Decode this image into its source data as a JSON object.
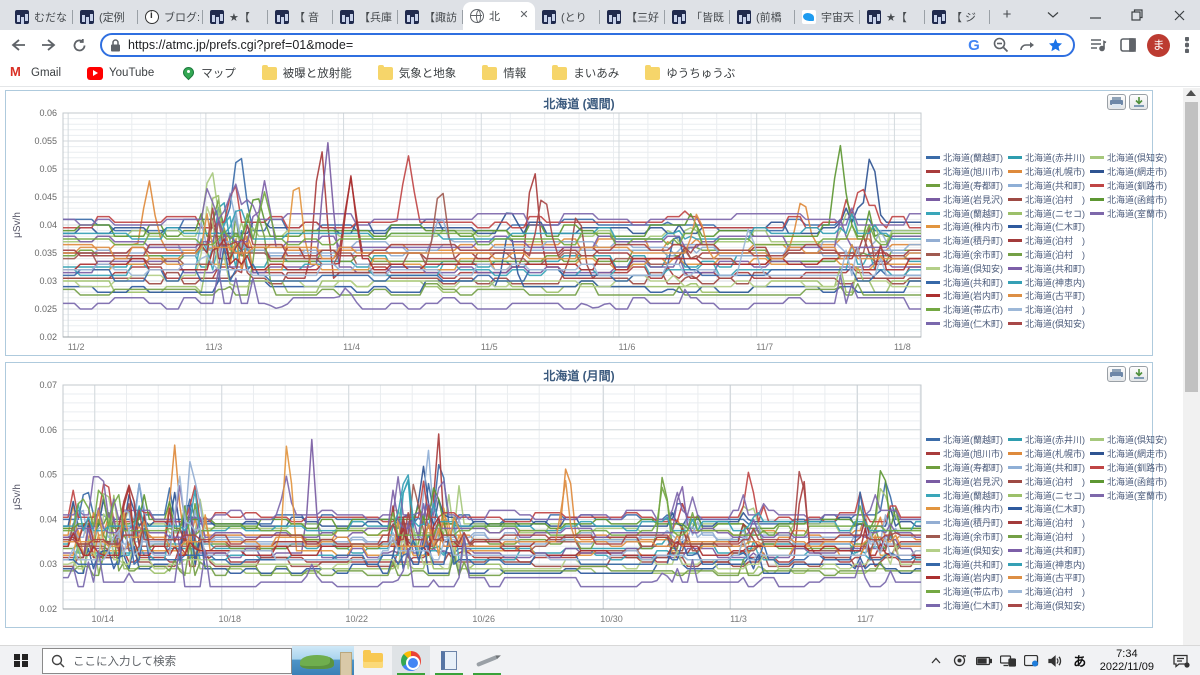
{
  "browser": {
    "tabs": [
      {
        "label": "むだな",
        "icon": "site"
      },
      {
        "label": "(定例",
        "icon": "site"
      },
      {
        "label": "ブログ:",
        "icon": "info"
      },
      {
        "label": "★【",
        "icon": "site"
      },
      {
        "label": "【 音",
        "icon": "site"
      },
      {
        "label": "【兵庫",
        "icon": "site"
      },
      {
        "label": "【諏訪",
        "icon": "site"
      },
      {
        "label": "北",
        "icon": "globe",
        "active": true
      },
      {
        "label": "(とり",
        "icon": "site"
      },
      {
        "label": "【三好",
        "icon": "site"
      },
      {
        "label": "「皆既",
        "icon": "site"
      },
      {
        "label": "(前橋",
        "icon": "site"
      },
      {
        "label": "宇宙天",
        "icon": "twitter"
      },
      {
        "label": "★【",
        "icon": "site"
      },
      {
        "label": "【 ジ",
        "icon": "site"
      }
    ],
    "address": {
      "url": "https://atmc.jp/prefs.cgi?pref=01&mode="
    },
    "bookmarks": [
      {
        "label": "Gmail",
        "icon": "gmail"
      },
      {
        "label": "YouTube",
        "icon": "youtube"
      },
      {
        "label": "マップ",
        "icon": "maps"
      },
      {
        "label": "被曝と放射能",
        "icon": "folder"
      },
      {
        "label": "気象と地象",
        "icon": "folder"
      },
      {
        "label": "情報",
        "icon": "folder"
      },
      {
        "label": "まいあみ",
        "icon": "folder"
      },
      {
        "label": "ゆうちゅうぶ",
        "icon": "folder"
      }
    ],
    "avatar_letter": "ま"
  },
  "chart_data": [
    {
      "type": "line",
      "title": "北海道 (週間)",
      "ylabel": "μSv/h",
      "ylim": [
        0.02,
        0.06
      ],
      "yticks": [
        "0.06",
        "0.055",
        "0.05",
        "0.045",
        "0.04",
        "0.035",
        "0.03",
        "0.025",
        "0.02"
      ],
      "y_minor": 0.001,
      "x_minor": 0.0401,
      "points": 150,
      "spike_w": 0.013,
      "xticks": [
        {
          "l": "11/2",
          "f": 0.006
        },
        {
          "l": "11/3",
          "f": 0.1665
        },
        {
          "l": "11/4",
          "f": 0.327
        },
        {
          "l": "11/5",
          "f": 0.4875
        },
        {
          "l": "11/6",
          "f": 0.648
        },
        {
          "l": "11/7",
          "f": 0.8085
        },
        {
          "l": "11/8",
          "f": 0.969
        }
      ],
      "legend_rows": [
        3,
        3,
        3,
        3,
        3,
        2,
        2,
        2,
        2,
        2,
        2,
        2,
        2
      ],
      "volatility": [
        {
          "f0": 0.155,
          "f1": 0.225,
          "a": 0.007
        },
        {
          "f0": 0.7,
          "f1": 0.74,
          "a": 0.002
        },
        {
          "f0": 0.9,
          "f1": 0.955,
          "a": 0.005
        }
      ],
      "series": [
        {
          "n": "北海道(蘭越町)",
          "c": "#3b6ca9",
          "b": 0.04,
          "s": [
            [
              0.205,
              0.0555
            ]
          ]
        },
        {
          "n": "北海道(赤井川)",
          "c": "#2e9daf",
          "b": 0.0335,
          "s": [
            [
              0.185,
              0.047
            ]
          ]
        },
        {
          "n": "北海道(倶知安)",
          "c": "#a6c87c",
          "b": 0.038,
          "s": [
            [
              0.172,
              0.052
            ]
          ]
        },
        {
          "n": "北海道(旭川市)",
          "c": "#a93c3c",
          "b": 0.0315,
          "s": [
            [
              0.3,
              0.057
            ],
            [
              0.548,
              0.053
            ]
          ]
        },
        {
          "n": "北海道(札幌市)",
          "c": "#de8a3c",
          "b": 0.0365,
          "s": [
            [
              0.1,
              0.0485
            ],
            [
              0.862,
              0.046
            ]
          ]
        },
        {
          "n": "北海道(網走市)",
          "c": "#2f5492",
          "b": 0.0395,
          "s": [
            [
              0.52,
              0.043
            ],
            [
              0.942,
              0.0545
            ]
          ]
        },
        {
          "n": "北海道(寿都町)",
          "c": "#6f9e3e",
          "b": 0.0345,
          "s": [
            [
              0.18,
              0.0455
            ]
          ]
        },
        {
          "n": "北海道(共和町)",
          "c": "#8fafd6",
          "b": 0.0355,
          "s": [
            [
              0.195,
              0.046
            ]
          ]
        },
        {
          "n": "北海道(釧路市)",
          "c": "#c04545",
          "b": 0.0405,
          "s": [
            [
              0.402,
              0.053
            ],
            [
              0.93,
              0.048
            ]
          ]
        },
        {
          "n": "北海道(岩見沢)",
          "c": "#7a5ca3",
          "b": 0.0325,
          "s": [
            [
              0.308,
              0.056
            ]
          ]
        },
        {
          "n": "北海道(泊村　)",
          "c": "#9e4a44",
          "b": 0.0305,
          "s": [
            [
              0.6,
              0.044
            ]
          ]
        },
        {
          "n": "北海道(函館市)",
          "c": "#5d9732",
          "b": 0.039,
          "s": [
            [
              0.225,
              0.0465
            ],
            [
              0.905,
              0.0555
            ]
          ]
        },
        {
          "n": "北海道(蘭越町)",
          "c": "#3aa6b9",
          "b": 0.0318,
          "s": [
            [
              0.192,
              0.044
            ]
          ]
        },
        {
          "n": "北海道(ニセコ)",
          "c": "#9cc06a",
          "b": 0.0292,
          "s": [
            [
              0.178,
              0.0505
            ]
          ]
        },
        {
          "n": "北海道(室蘭市)",
          "c": "#7e68ab",
          "b": 0.041,
          "s": [
            [
              0.2,
              0.048
            ]
          ]
        },
        {
          "n": "北海道(稚内市)",
          "c": "#e2953f",
          "b": 0.0332,
          "s": [
            [
              0.272,
              0.051
            ]
          ]
        },
        {
          "n": "北海道(仁木町)",
          "c": "#2f5a9e",
          "b": 0.0288,
          "s": [
            [
              0.52,
              0.0405
            ]
          ]
        },
        {
          "n": "北海道(積丹町)",
          "c": "#93aed3",
          "b": 0.0358,
          "s": [
            [
              0.44,
              0.0425
            ]
          ]
        },
        {
          "n": "北海道(泊村　)",
          "c": "#a33b3b",
          "b": 0.0352,
          "s": [
            [
              0.335,
              0.049
            ]
          ]
        },
        {
          "n": "北海道(余市町)",
          "c": "#a05a50",
          "b": 0.0342,
          "s": [
            [
              0.44,
              0.049
            ]
          ]
        },
        {
          "n": "北海道(泊村　)",
          "c": "#74a046",
          "b": 0.0285,
          "s": [
            [
              0.23,
              0.0435
            ]
          ]
        },
        {
          "n": "北海道(倶知安)",
          "c": "#b4cf88",
          "b": 0.0298,
          "s": [
            [
              0.17,
              0.046
            ]
          ]
        },
        {
          "n": "北海道(共和町)",
          "c": "#7d5fa8",
          "b": 0.0372,
          "s": [
            [
              0.235,
              0.048
            ]
          ]
        },
        {
          "n": "北海道(共和町)",
          "c": "#3668a8",
          "b": 0.031,
          "s": [
            [
              0.715,
              0.04
            ]
          ]
        },
        {
          "n": "北海道(神恵内)",
          "c": "#35a0b5",
          "b": 0.0385,
          "s": [
            [
              0.205,
              0.044
            ]
          ]
        },
        {
          "n": "北海道(岩内町)",
          "c": "#ab3030",
          "b": 0.033,
          "s": [
            [
              0.335,
              0.0495
            ]
          ]
        },
        {
          "n": "北海道(古平町)",
          "c": "#dd8f45",
          "b": 0.0348,
          "s": [
            [
              0.74,
              0.043
            ]
          ]
        },
        {
          "n": "北海道(帯広市)",
          "c": "#74a843",
          "b": 0.0376,
          "s": [
            [
              0.235,
              0.046
            ]
          ]
        },
        {
          "n": "北海道(泊村　)",
          "c": "#9db8d8",
          "b": 0.0322,
          "s": [
            [
              0.8,
              0.04
            ]
          ]
        },
        {
          "n": "北海道(仁木町)",
          "c": "#7a68ad",
          "b": 0.026,
          "s": [
            [
              0.33,
              0.029
            ],
            [
              0.25,
              0.025
            ],
            [
              0.62,
              0.025
            ]
          ]
        },
        {
          "n": "北海道(倶知安)",
          "c": "#a84848",
          "b": 0.0356,
          "s": [
            [
              0.56,
              0.047
            ]
          ]
        }
      ]
    },
    {
      "type": "line",
      "title": "北海道 (月間)",
      "ylabel": "μSv/h",
      "ylim": [
        0.02,
        0.07
      ],
      "yticks": [
        "0.07",
        "0.06",
        "0.05",
        "0.04",
        "0.03",
        "0.02"
      ],
      "y_minor": 0.002,
      "x_minor": 0.037,
      "points": 170,
      "spike_w": 0.009,
      "xticks": [
        {
          "l": "10/14",
          "f": 0.037
        },
        {
          "l": "10/18",
          "f": 0.185
        },
        {
          "l": "10/22",
          "f": 0.333
        },
        {
          "l": "10/26",
          "f": 0.481
        },
        {
          "l": "10/30",
          "f": 0.63
        },
        {
          "l": "11/3",
          "f": 0.778
        },
        {
          "l": "11/7",
          "f": 0.926
        }
      ],
      "legend_rows": [
        3,
        3,
        3,
        3,
        3,
        2,
        2,
        2,
        2,
        2,
        2,
        2,
        2
      ],
      "volatility": [
        {
          "f0": 0.01,
          "f1": 0.1,
          "a": 0.008
        },
        {
          "f0": 0.12,
          "f1": 0.17,
          "a": 0.009
        },
        {
          "f0": 0.38,
          "f1": 0.47,
          "a": 0.009
        },
        {
          "f0": 0.7,
          "f1": 0.745,
          "a": 0.005
        },
        {
          "f0": 0.79,
          "f1": 0.82,
          "a": 0.004
        },
        {
          "f0": 0.925,
          "f1": 0.975,
          "a": 0.005
        }
      ],
      "series": [
        {
          "n": "北海道(蘭越町)",
          "c": "#3b6ca9",
          "b": 0.04,
          "s": [
            [
              0.44,
              0.056
            ],
            [
              0.96,
              0.05
            ]
          ]
        },
        {
          "n": "北海道(赤井川)",
          "c": "#2e9daf",
          "b": 0.0335,
          "s": [
            [
              0.4,
              0.054
            ]
          ]
        },
        {
          "n": "北海道(倶知安)",
          "c": "#a6c87c",
          "b": 0.038,
          "s": [
            [
              0.05,
              0.049
            ],
            [
              0.955,
              0.05
            ]
          ]
        },
        {
          "n": "北海道(旭川市)",
          "c": "#a93c3c",
          "b": 0.0315,
          "s": [
            [
              0.437,
              0.062
            ],
            [
              0.862,
              0.053
            ]
          ]
        },
        {
          "n": "北海道(札幌市)",
          "c": "#de8a3c",
          "b": 0.0365,
          "s": [
            [
              0.13,
              0.057
            ],
            [
              0.588,
              0.056
            ]
          ]
        },
        {
          "n": "北海道(網走市)",
          "c": "#2f5492",
          "b": 0.0395,
          "s": [
            [
              0.42,
              0.052
            ]
          ]
        },
        {
          "n": "北海道(寿都町)",
          "c": "#6f9e3e",
          "b": 0.0345,
          "s": [
            [
              0.7,
              0.053
            ]
          ]
        },
        {
          "n": "北海道(共和町)",
          "c": "#8fafd6",
          "b": 0.0355,
          "s": [
            [
              0.425,
              0.058
            ],
            [
              0.09,
              0.05
            ]
          ]
        },
        {
          "n": "北海道(釧路市)",
          "c": "#c04545",
          "b": 0.0405,
          "s": [
            [
              0.8,
              0.052
            ],
            [
              0.05,
              0.051
            ]
          ]
        },
        {
          "n": "北海道(岩見沢)",
          "c": "#7a5ca3",
          "b": 0.0325,
          "s": [
            [
              0.29,
              0.058
            ]
          ]
        },
        {
          "n": "北海道(泊村　)",
          "c": "#9e4a44",
          "b": 0.0305,
          "s": [
            [
              0.075,
              0.047
            ]
          ]
        },
        {
          "n": "北海道(函館市)",
          "c": "#5d9732",
          "b": 0.039,
          "s": [
            [
              0.955,
              0.055
            ]
          ]
        },
        {
          "n": "北海道(蘭越町)",
          "c": "#3aa6b9",
          "b": 0.0318,
          "s": [
            [
              0.4,
              0.055
            ]
          ]
        },
        {
          "n": "北海道(ニセコ)",
          "c": "#9cc06a",
          "b": 0.0292,
          "s": [
            [
              0.06,
              0.047
            ]
          ]
        },
        {
          "n": "北海道(室蘭市)",
          "c": "#7e68ab",
          "b": 0.041,
          "s": [
            [
              0.26,
              0.05
            ]
          ]
        },
        {
          "n": "北海道(稚内市)",
          "c": "#e2953f",
          "b": 0.0332,
          "s": [
            [
              0.262,
              0.0615
            ]
          ]
        },
        {
          "n": "北海道(仁木町)",
          "c": "#2f5a9e",
          "b": 0.0288,
          "s": [
            [
              0.145,
              0.05
            ]
          ]
        },
        {
          "n": "北海道(積丹町)",
          "c": "#93aed3",
          "b": 0.0358,
          "s": [
            [
              0.15,
              0.058
            ]
          ]
        },
        {
          "n": "北海道(泊村　)",
          "c": "#a33b3b",
          "b": 0.0352,
          "s": [
            [
              0.075,
              0.051
            ]
          ]
        },
        {
          "n": "北海道(余市町)",
          "c": "#a05a50",
          "b": 0.0342,
          "s": [
            [
              0.41,
              0.051
            ]
          ]
        },
        {
          "n": "北海道(泊村　)",
          "c": "#74a046",
          "b": 0.0285,
          "s": [
            [
              0.055,
              0.043
            ]
          ]
        },
        {
          "n": "北海道(倶知安)",
          "c": "#b4cf88",
          "b": 0.0298,
          "s": [
            [
              0.05,
              0.046
            ]
          ]
        },
        {
          "n": "北海道(共和町)",
          "c": "#7d5fa8",
          "b": 0.0372,
          "s": [
            [
              0.72,
              0.05
            ]
          ]
        },
        {
          "n": "北海道(共和町)",
          "c": "#3668a8",
          "b": 0.031,
          "s": [
            [
              0.93,
              0.048
            ]
          ]
        },
        {
          "n": "北海道(神恵内)",
          "c": "#35a0b5",
          "b": 0.0385,
          "s": [
            [
              0.4,
              0.054
            ]
          ]
        },
        {
          "n": "北海道(岩内町)",
          "c": "#ab3030",
          "b": 0.033,
          "s": [
            [
              0.075,
              0.051
            ]
          ]
        },
        {
          "n": "北海道(古平町)",
          "c": "#dd8f45",
          "b": 0.0348,
          "s": [
            [
              0.585,
              0.05
            ]
          ]
        },
        {
          "n": "北海道(帯広市)",
          "c": "#74a843",
          "b": 0.0376,
          "s": [
            [
              0.7,
              0.0495
            ]
          ]
        },
        {
          "n": "北海道(泊村　)",
          "c": "#9db8d8",
          "b": 0.0322,
          "s": [
            [
              0.135,
              0.052
            ]
          ]
        },
        {
          "n": "北海道(仁木町)",
          "c": "#7a68ad",
          "b": 0.026,
          "s": [
            [
              0.29,
              0.03
            ],
            [
              0.7,
              0.0285
            ],
            [
              0.18,
              0.025
            ]
          ]
        },
        {
          "n": "北海道(倶知安)",
          "c": "#a84848",
          "b": 0.0356,
          "s": [
            [
              0.86,
              0.055
            ]
          ]
        }
      ]
    }
  ],
  "taskbar": {
    "search_placeholder": "ここに入力して検索",
    "ime": "あ",
    "clock": {
      "time": "7:34",
      "date": "2022/11/09"
    }
  }
}
